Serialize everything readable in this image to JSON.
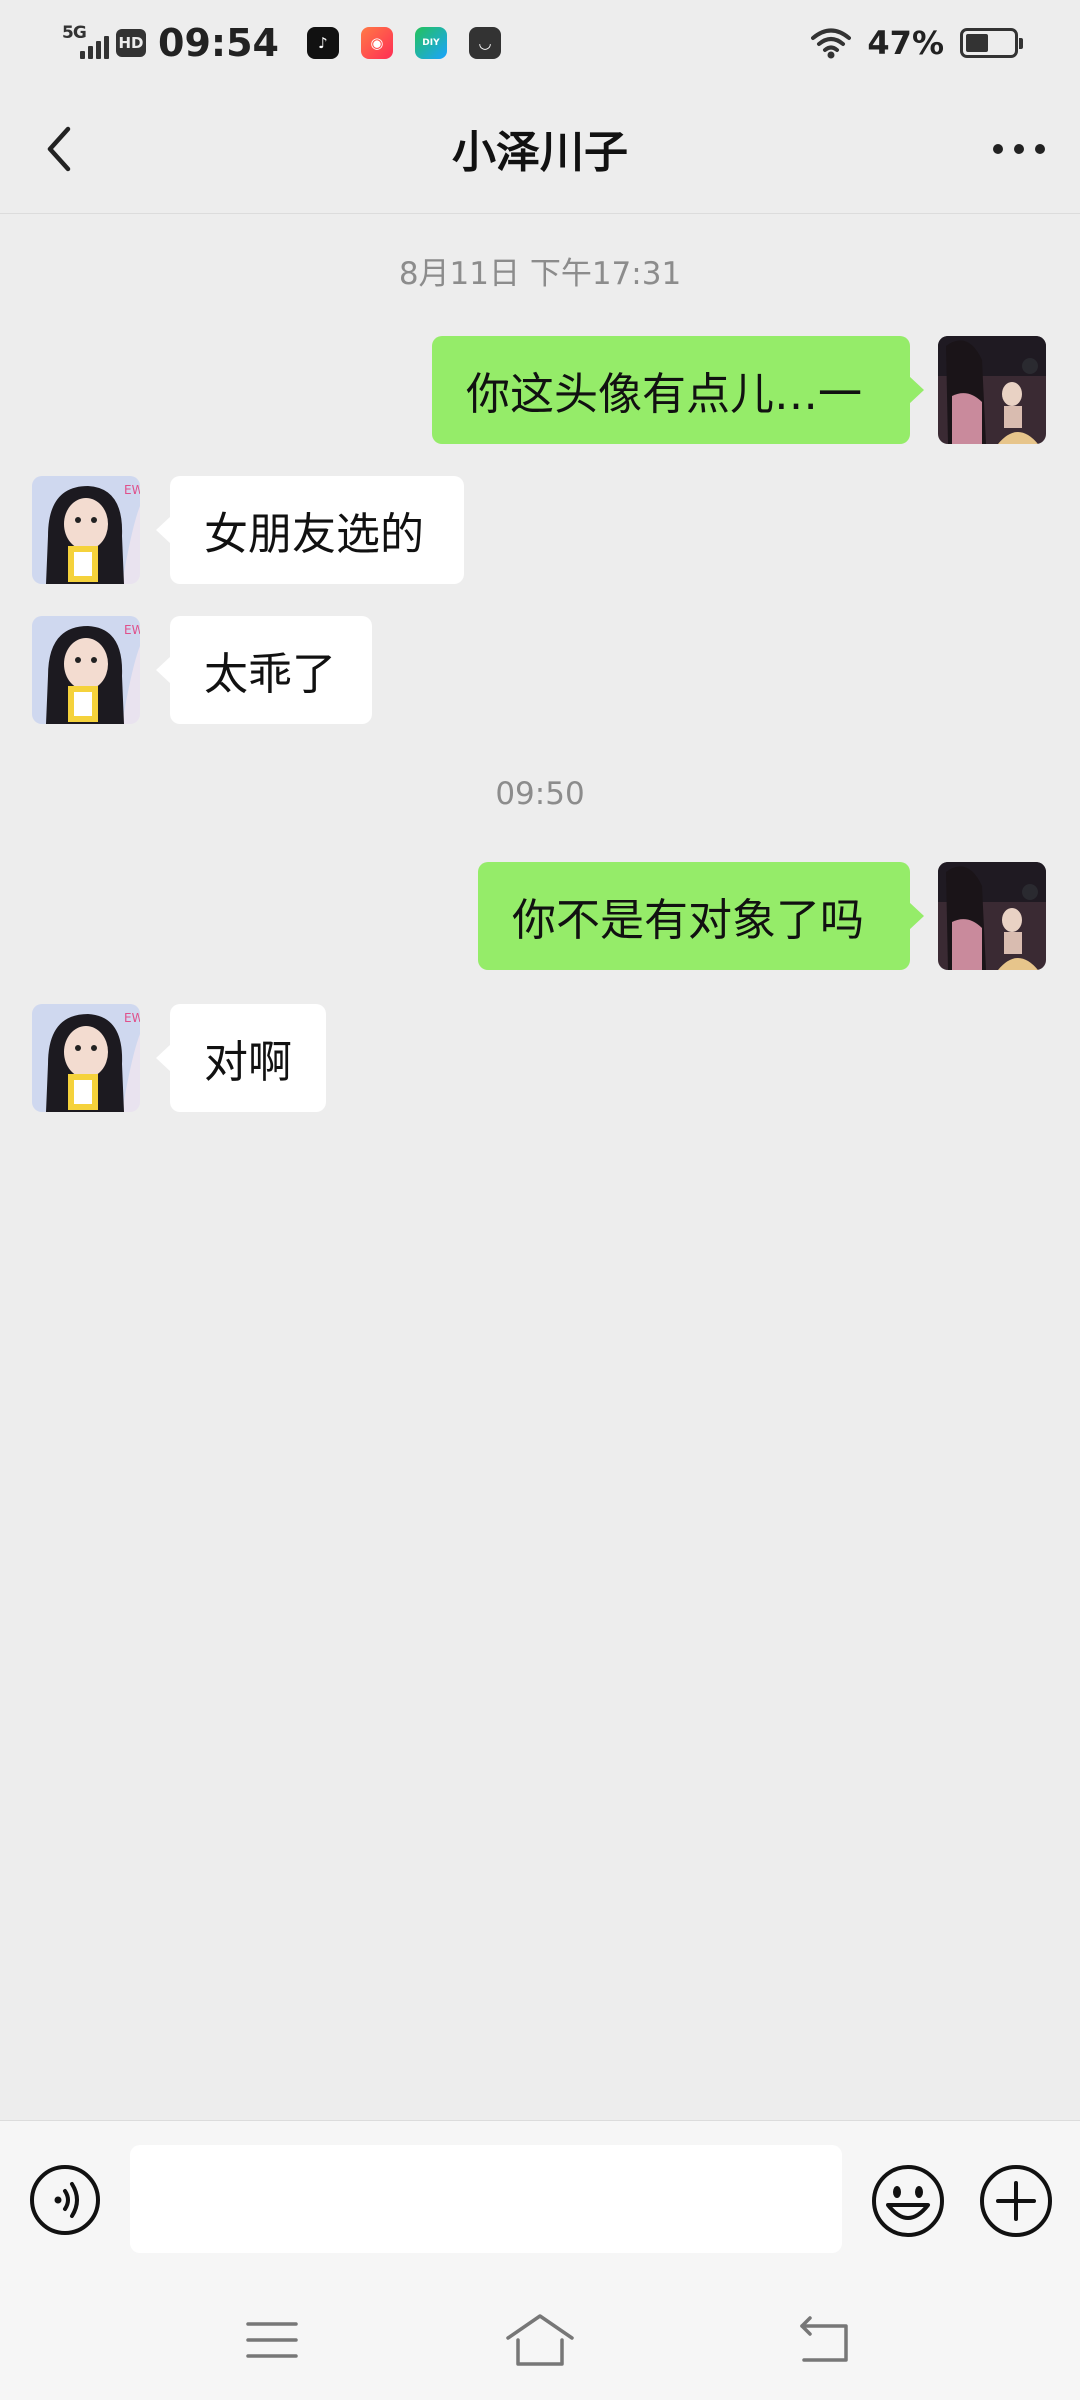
{
  "status_bar": {
    "network": "5G",
    "hd_label": "HD",
    "time": "09:54",
    "battery_percent": "47%",
    "battery_level": 0.47,
    "icons": [
      "signal-icon",
      "tiktok-app-icon",
      "kuaishou-app-icon",
      "diy-app-icon",
      "shop-app-icon",
      "wifi-icon",
      "battery-icon"
    ]
  },
  "header": {
    "title": "小泽川子",
    "back_icon": "chevron-left-icon",
    "more_icon": "more-dots-icon"
  },
  "messages": {
    "ts1": "8月11日 下午17:31",
    "m1": "你这头像有点儿…一",
    "m2": "女朋友选的",
    "m3": "太乖了",
    "ts2": "09:50",
    "m4": "你不是有对象了吗",
    "m5": "对啊"
  },
  "input_bar": {
    "placeholder": "",
    "voice_icon": "voice-icon",
    "emoji_icon": "emoji-icon",
    "plus_icon": "plus-icon"
  },
  "colors": {
    "outgoing_bubble": "#95ec69",
    "incoming_bubble": "#ffffff",
    "background": "#ededed"
  }
}
